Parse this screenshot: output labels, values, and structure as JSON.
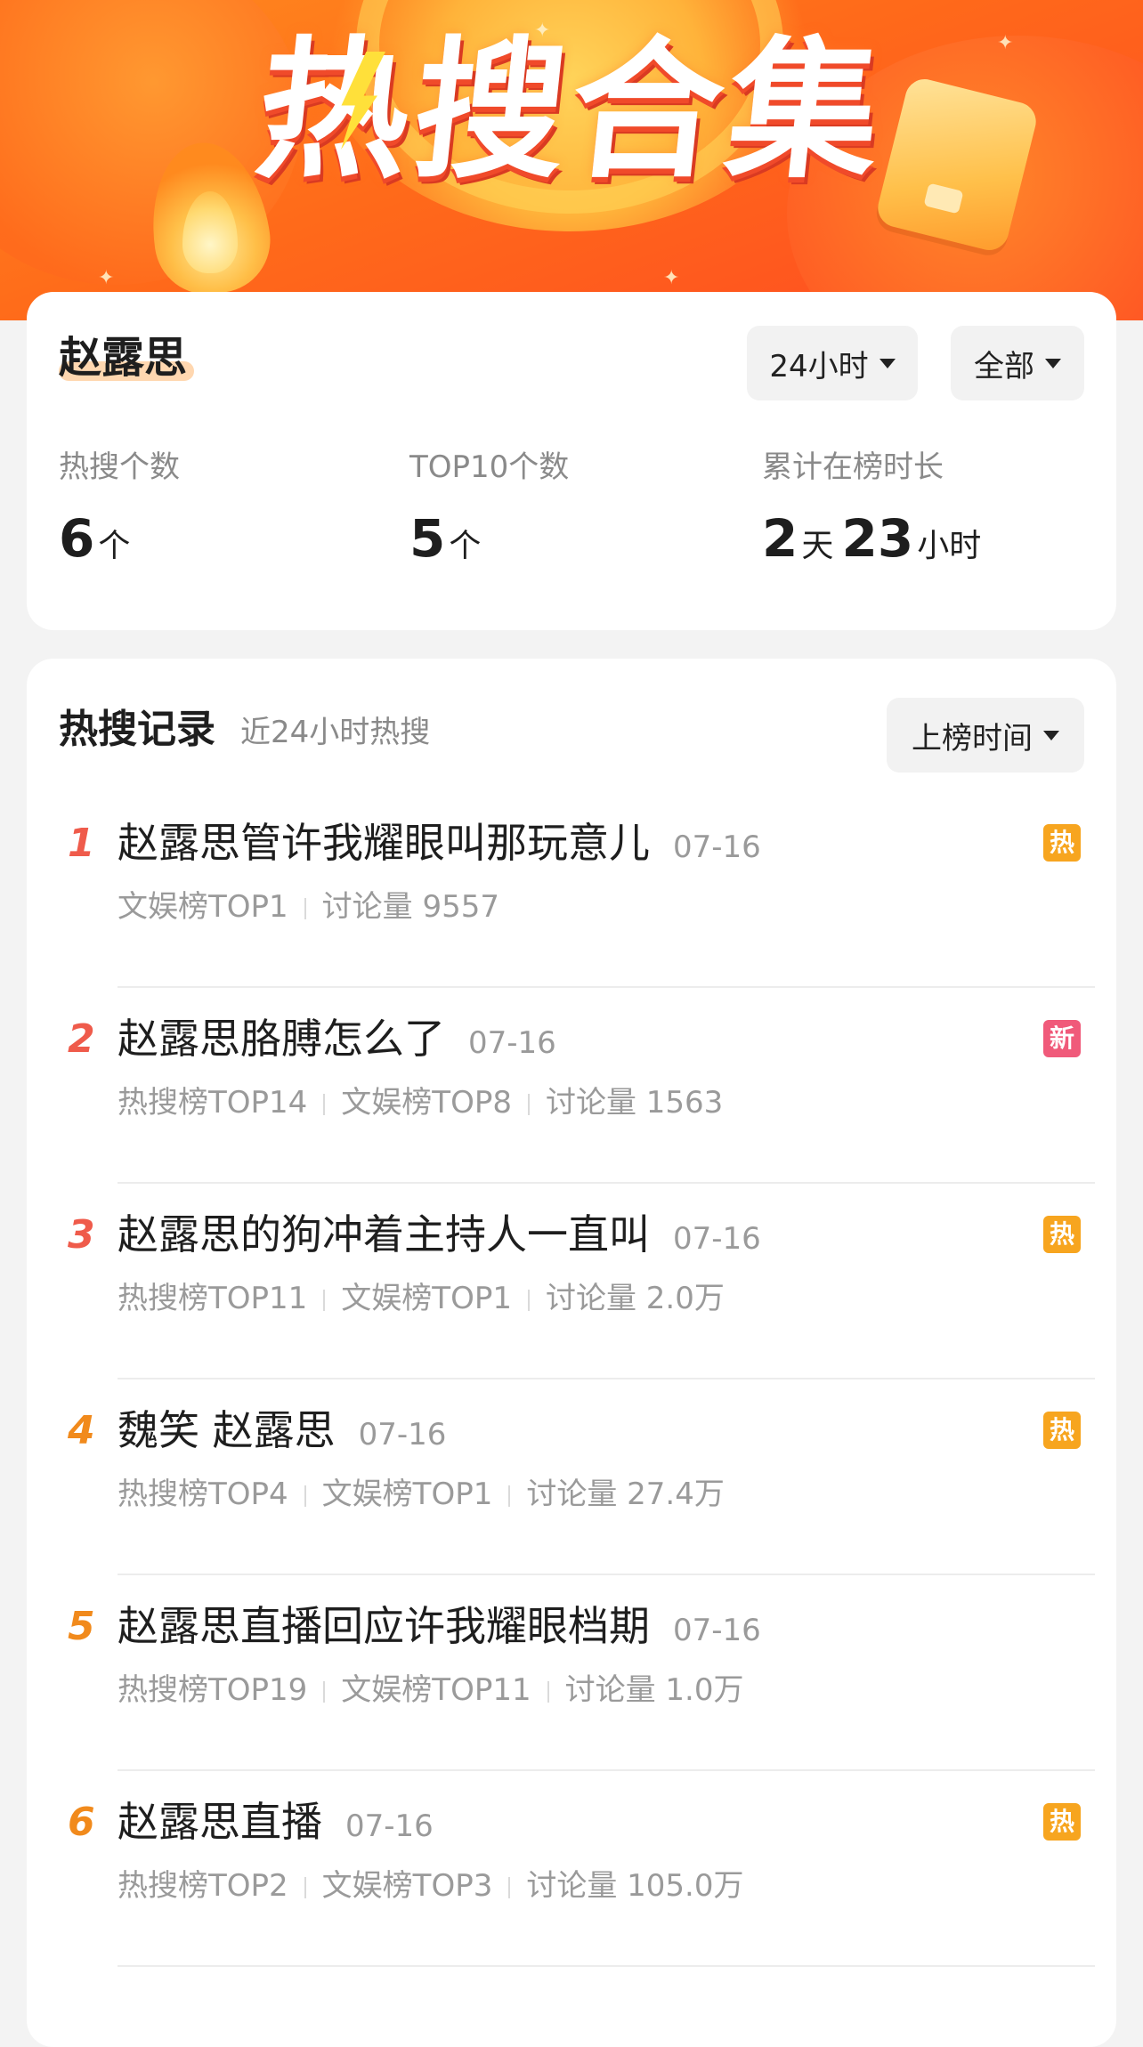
{
  "banner": {
    "title": "热搜合集"
  },
  "summary": {
    "name": "赵露思",
    "filters": {
      "time_label": "24小时",
      "scope_label": "全部"
    },
    "stats": [
      {
        "label": "热搜个数",
        "value": "6",
        "unit": "个"
      },
      {
        "label": "TOP10个数",
        "value": "5",
        "unit": "个"
      },
      {
        "label": "累计在榜时长",
        "days": "2",
        "days_unit": "天",
        "hours": "23",
        "hours_unit": "小时"
      }
    ]
  },
  "records": {
    "title": "热搜记录",
    "subtitle": "近24小时热搜",
    "sort_label": "上榜时间",
    "items": [
      {
        "rank": "1",
        "topic": "赵露思管许我耀眼叫那玩意儿",
        "date": "07-16",
        "meta": [
          "文娱榜TOP1",
          "讨论量 9557"
        ],
        "badge": "热",
        "badge_type": "hot"
      },
      {
        "rank": "2",
        "topic": "赵露思胳膊怎么了",
        "date": "07-16",
        "meta": [
          "热搜榜TOP14",
          "文娱榜TOP8",
          "讨论量 1563"
        ],
        "badge": "新",
        "badge_type": "new"
      },
      {
        "rank": "3",
        "topic": "赵露思的狗冲着主持人一直叫",
        "date": "07-16",
        "meta": [
          "热搜榜TOP11",
          "文娱榜TOP1",
          "讨论量 2.0万"
        ],
        "badge": "热",
        "badge_type": "hot"
      },
      {
        "rank": "4",
        "topic": "魏笑 赵露思",
        "date": "07-16",
        "meta": [
          "热搜榜TOP4",
          "文娱榜TOP1",
          "讨论量 27.4万"
        ],
        "badge": "热",
        "badge_type": "hot"
      },
      {
        "rank": "5",
        "topic": "赵露思直播回应许我耀眼档期",
        "date": "07-16",
        "meta": [
          "热搜榜TOP19",
          "文娱榜TOP11",
          "讨论量 1.0万"
        ],
        "badge": "",
        "badge_type": ""
      },
      {
        "rank": "6",
        "topic": "赵露思直播",
        "date": "07-16",
        "meta": [
          "热搜榜TOP2",
          "文娱榜TOP3",
          "讨论量 105.0万"
        ],
        "badge": "热",
        "badge_type": "hot"
      }
    ]
  },
  "colors": {
    "banner_orange": "#ff6a1a",
    "rank_top": "#ef5b4b",
    "rank_mid": "#f18a1c",
    "badge_hot": "#f7a51f",
    "badge_new": "#f05a7a"
  }
}
